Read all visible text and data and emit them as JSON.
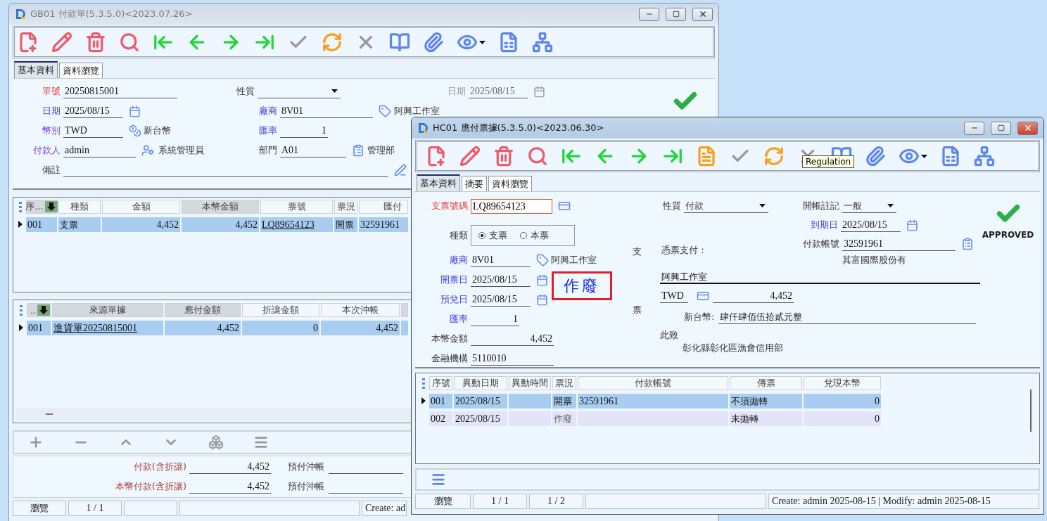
{
  "left_window": {
    "title": "GB01 付款單(5.3.5.0)<2023.07.26>",
    "active": false,
    "tabs": [
      {
        "label": "基本資料",
        "selected": true
      },
      {
        "label": "資料瀏覽",
        "selected": false
      }
    ],
    "form": {
      "order_no": {
        "label": "單號",
        "value": "20250815001",
        "kind": "required"
      },
      "nature": {
        "label": "性質"
      },
      "doc_date": {
        "label": "日期",
        "value": "2025/08/15",
        "disabled": true
      },
      "date": {
        "label": "日期",
        "value": "2025/08/15",
        "kind": "lookup"
      },
      "vendor": {
        "label": "廠商",
        "value": "8V01",
        "name": "阿興工作室",
        "kind": "lookup"
      },
      "currency": {
        "label": "幣別",
        "value": "TWD",
        "name": "新台幣",
        "kind": "user"
      },
      "rate": {
        "label": "匯率",
        "value": "1",
        "kind": "lookup"
      },
      "payer": {
        "label": "付款人",
        "value": "admin",
        "name": "系統管理員",
        "kind": "user"
      },
      "department": {
        "label": "部門",
        "value": "A01",
        "name": "管理部"
      },
      "note": {
        "label": "備註"
      }
    },
    "approved": true,
    "grid1": {
      "columns": [
        {
          "label": "序...",
          "link": false
        },
        {
          "label": "種類",
          "link": false
        },
        {
          "label": "金額",
          "link": false
        },
        {
          "label": "本幣金額",
          "link": false
        },
        {
          "label": "票號",
          "link": true
        },
        {
          "label": "票況",
          "link": false
        },
        {
          "label": "匯付",
          "link": false
        }
      ],
      "rows": [
        {
          "cells": [
            "001",
            "支票",
            "4,452",
            "4,452",
            "LQ89654123",
            "開票",
            "32591961"
          ],
          "selected": true
        }
      ]
    },
    "grid2": {
      "columns": [
        {
          "label": "..",
          "link": false
        },
        {
          "label": "來源單據",
          "link": true
        },
        {
          "label": "應付金額",
          "link": false
        },
        {
          "label": "折讓金額",
          "link": false
        },
        {
          "label": "本次沖帳",
          "link": false
        }
      ],
      "rows": [
        {
          "cells": [
            "001",
            "進貨單20250815001",
            "4,452",
            "0",
            "4,452"
          ],
          "selected": true
        }
      ]
    },
    "totals": [
      {
        "label": "付款(含折讓)",
        "value": "4,452",
        "label2": "預付沖帳"
      },
      {
        "label": "本幣付款(含折讓)",
        "value": "4,452",
        "label2": "預付沖帳"
      }
    ],
    "status_bar": {
      "mode": "瀏覽",
      "record": "1 / 1",
      "info": "Create: ad"
    }
  },
  "right_window": {
    "title": "HC01 應付票據(5.3.5.0)<2023.06.30>",
    "active": true,
    "tooltip": "Regulation",
    "tabs": [
      {
        "label": "基本資料",
        "selected": true
      },
      {
        "label": "摘要",
        "selected": false
      },
      {
        "label": "資料瀏覽",
        "selected": false
      }
    ],
    "form": {
      "cheque_no": {
        "label": "支票號碼",
        "value": "LQ89654123",
        "kind": "required",
        "focused": true
      },
      "kind": {
        "label": "種類",
        "options": [
          {
            "label": "支票",
            "selected": true
          },
          {
            "label": "本票",
            "selected": false
          }
        ]
      },
      "vendor": {
        "label": "廠商",
        "value": "8V01",
        "name": "阿興工作室",
        "kind": "lookup"
      },
      "issue_date": {
        "label": "開票日",
        "value": "2025/08/15",
        "kind": "lookup"
      },
      "cash_date": {
        "label": "預兌日",
        "value": "2025/08/15",
        "kind": "lookup"
      },
      "rate": {
        "label": "匯率",
        "value": "1",
        "kind": "lookup"
      },
      "local_amount": {
        "label": "本幣金額",
        "value": "4,452"
      },
      "bank": {
        "label": "金融機構",
        "value": "5110010"
      },
      "nature": {
        "label": "性質",
        "value": "付款"
      },
      "opening": {
        "label": "開帳註記",
        "value": "一般"
      },
      "due_date": {
        "label": "到期日",
        "value": "2025/08/15",
        "kind": "lookup"
      },
      "account": {
        "label": "付款帳號",
        "value": "32591961",
        "name": "其富國際股份有"
      }
    },
    "void_stamp": "作廢",
    "cheque": {
      "side_labels": [
        "支",
        "票"
      ],
      "pay_to_label": "憑票支付：",
      "payee": "阿興工作室",
      "currency": "TWD",
      "amount": "4,452",
      "words_label": "新台幣:",
      "amount_words": "肆仟肆佰伍拾貳元整",
      "closing": "此致",
      "bank_name": "彰化縣彰化區漁會信用部"
    },
    "approved": true,
    "approved_label": "APPROVED",
    "grid": {
      "columns": [
        {
          "label": "序號"
        },
        {
          "label": "異動日期"
        },
        {
          "label": "異動時間"
        },
        {
          "label": "票況"
        },
        {
          "label": "付款帳號"
        },
        {
          "label": "傳票"
        },
        {
          "label": "兌現本幣"
        }
      ],
      "rows": [
        {
          "cells": [
            "001",
            "2025/08/15",
            null,
            "開票",
            "32591961",
            "不須拋轉",
            "0"
          ],
          "selected": true
        },
        {
          "cells": [
            "002",
            "2025/08/15",
            null,
            "作廢",
            null,
            "未拋轉",
            "0"
          ],
          "selected": false
        }
      ]
    },
    "status_bar": {
      "mode": "瀏覽",
      "record": "1 / 1",
      "page": "1 / 2",
      "info": "Create: admin 2025-08-15 | Modify: admin 2025-08-15"
    }
  }
}
